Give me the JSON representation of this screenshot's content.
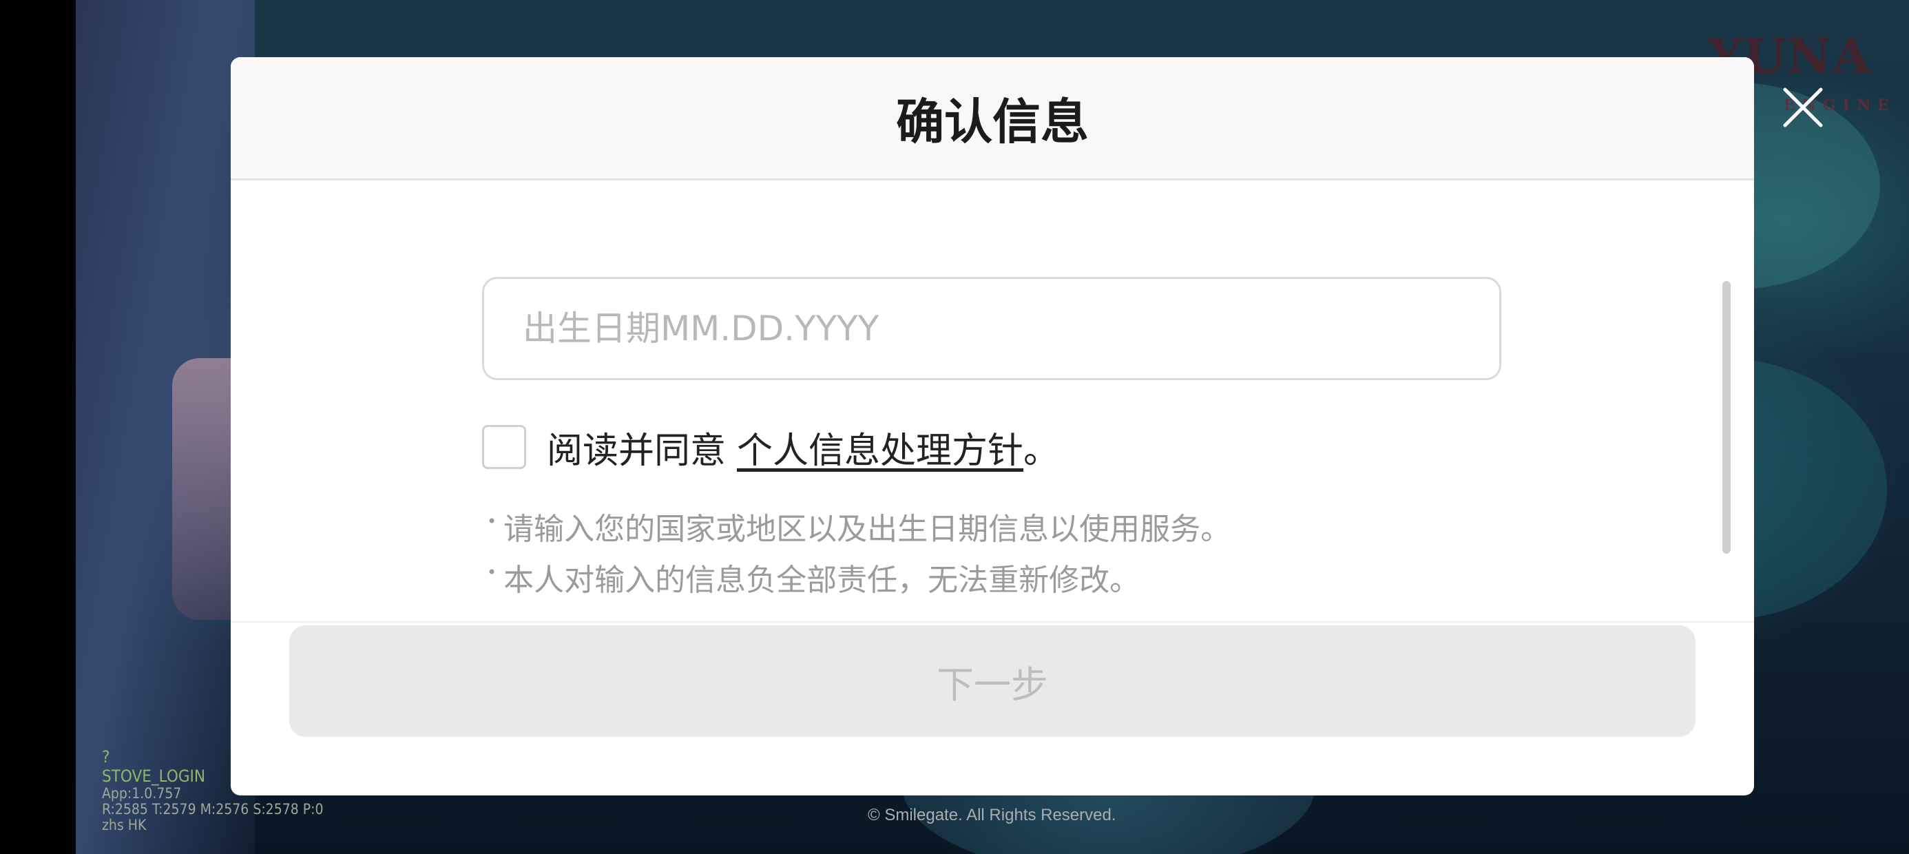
{
  "modal": {
    "title": "确认信息",
    "birthdate_placeholder": "出生日期MM.DD.YYYY",
    "birthdate_value": "",
    "agree_prefix": "阅读并同意",
    "agree_link": "个人信息处理方针",
    "agree_suffix": "。",
    "agree_checked": false,
    "notes": [
      "请输入您的国家或地区以及出生日期信息以使用服务。",
      "本人对输入的信息负全部责任，无法重新修改。"
    ],
    "next_label": "下一步",
    "next_enabled": false
  },
  "close_icon": "close-icon",
  "logo_text": "YUNA",
  "logo_sub": "ENGINE",
  "debug": {
    "line1": "?",
    "line2": "STOVE_LOGIN",
    "line3": "App:1.0.757",
    "line4": "R:2585 T:2579 M:2576 S:2578 P:0",
    "line5": "zhs  HK"
  },
  "footer": {
    "copyright": "© Smilegate. All Rights Reserved."
  },
  "colors": {
    "primary_text": "#1b1b1b",
    "muted_text": "#9b9b9b",
    "disabled_button": "#e9e9e9"
  }
}
